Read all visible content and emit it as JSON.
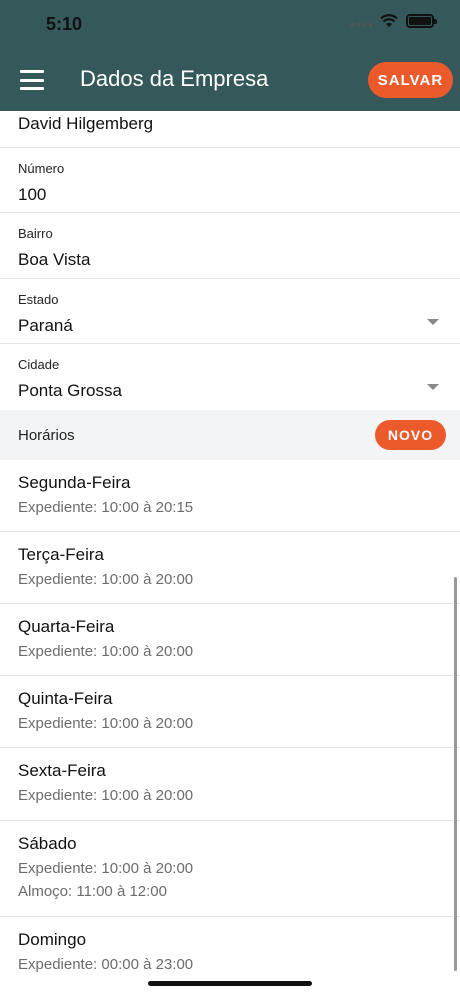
{
  "status_bar": {
    "time": "5:10"
  },
  "header": {
    "title": "Dados da Empresa",
    "save_label": "SALVAR"
  },
  "fields": {
    "name_value": "David Hilgemberg",
    "numero": {
      "label": "Número",
      "value": "100"
    },
    "bairro": {
      "label": "Bairro",
      "value": "Boa Vista"
    },
    "estado": {
      "label": "Estado",
      "value": "Paraná"
    },
    "cidade": {
      "label": "Cidade",
      "value": "Ponta Grossa"
    }
  },
  "horarios": {
    "label": "Horários",
    "new_label": "NOVO",
    "days": [
      {
        "name": "Segunda-Feira",
        "expediente": "Expediente: 10:00 à 20:15"
      },
      {
        "name": "Terça-Feira",
        "expediente": "Expediente: 10:00 à 20:00"
      },
      {
        "name": "Quarta-Feira",
        "expediente": "Expediente: 10:00 à 20:00"
      },
      {
        "name": "Quinta-Feira",
        "expediente": "Expediente: 10:00 à 20:00"
      },
      {
        "name": "Sexta-Feira",
        "expediente": "Expediente: 10:00 à 20:00"
      },
      {
        "name": "Sábado",
        "expediente": "Expediente: 10:00 à 20:00",
        "almoco": "Almoço: 11:00 à 12:00"
      },
      {
        "name": "Domingo",
        "expediente": "Expediente: 00:00 à 23:00"
      }
    ]
  },
  "colors": {
    "header_bg": "#35585a",
    "accent": "#ec5a2b"
  }
}
